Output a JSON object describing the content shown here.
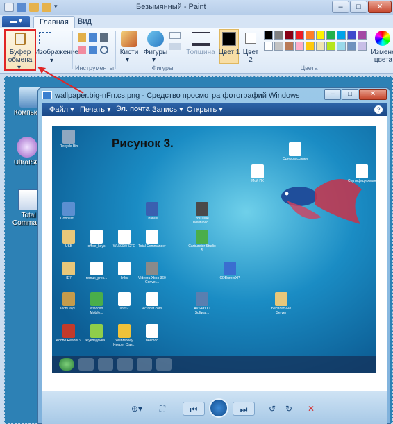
{
  "paint": {
    "title": "Безымянный - Paint",
    "tabs": [
      "Главная",
      "Вид"
    ],
    "groups": {
      "clipboard": "Буфер обмена",
      "image": "Изображение",
      "tools": "Инструменты",
      "brushes": "Кисти",
      "shapes": "Фигуры",
      "shapes_group": "Фигуры",
      "size": "Толщина",
      "color1": "Цвет 1",
      "color2": "Цвет 2",
      "colors": "Цвета",
      "edit_colors": "Измене цвета"
    },
    "palette": [
      "#000000",
      "#7f7f7f",
      "#880015",
      "#ed1c24",
      "#ff7f27",
      "#fff200",
      "#22b14c",
      "#00a2e8",
      "#3f48cc",
      "#a349a4",
      "#ffffff",
      "#c3c3c3",
      "#b97a57",
      "#ffaec9",
      "#ffc90e",
      "#efe4b0",
      "#b5e61d",
      "#99d9ea",
      "#7092be",
      "#c8bfe7"
    ]
  },
  "desktop": {
    "icons": [
      "Компьюте",
      "UltraISO",
      "Total Command"
    ]
  },
  "viewer": {
    "title": "wallpaper.big-nFn.cs.png - Средство просмотра фотографий Windows",
    "menu": [
      "Файл ▾",
      "Печать ▾",
      "Эл. почта",
      "Запись ▾",
      "Открыть ▾"
    ],
    "help": "?",
    "caption": "Рисунок 3."
  },
  "photo_icons": [
    "Recycle Bin",
    "Connecti...",
    "USB",
    "office_keys",
    "WL500W CFG",
    "Total Commander",
    "IE7",
    "remux_pres...",
    "links",
    "Videora Xbox 360 Conver...",
    "TechDays...",
    "Windows Mobile...",
    "links2",
    "Acrobat.com",
    "Adobe Reader 9",
    "Жукладочка...",
    "WebMoney Keeper Clas...",
    "beemdd",
    "Uranus",
    "YouTube Download...",
    "Carburetor Studio 5",
    "CDBurnerXP",
    "AVS4YOU Softwar...",
    "Бесплатные Server",
    "Одноклассники",
    "Сертифицированный...",
    "Мой ПК"
  ]
}
